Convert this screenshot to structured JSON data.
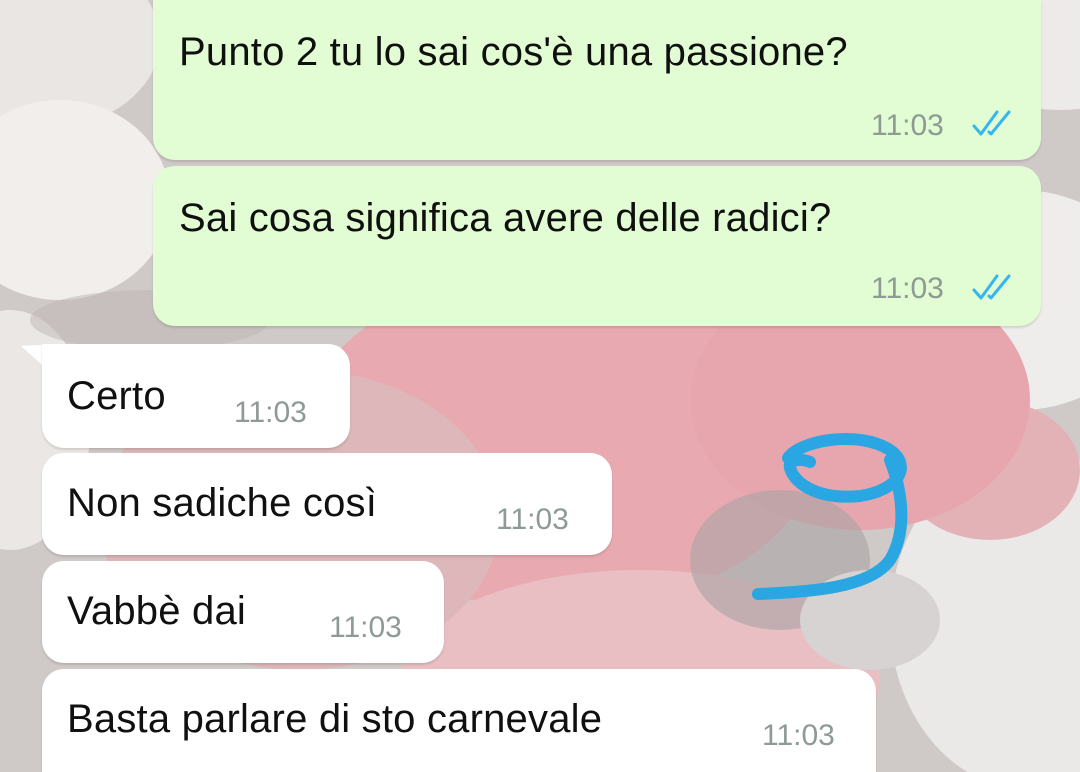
{
  "chat": {
    "messages": [
      {
        "direction": "outgoing",
        "text": "Punto 2 tu lo sai cos'è una passione?",
        "time": "11:03",
        "status_icon": "double-check-icon",
        "status_color": "#34b7f1"
      },
      {
        "direction": "outgoing",
        "text": "Sai cosa significa avere delle radici?",
        "time": "11:03",
        "status_icon": "double-check-icon",
        "status_color": "#34b7f1"
      },
      {
        "direction": "incoming",
        "text": "Certo",
        "time": "11:03"
      },
      {
        "direction": "incoming",
        "text": "Non sadiche così",
        "time": "11:03"
      },
      {
        "direction": "incoming",
        "text": "Vabbè dai",
        "time": "11:03"
      },
      {
        "direction": "incoming",
        "text": "Basta parlare di sto carnevale",
        "time": "11:03"
      }
    ]
  },
  "colors": {
    "outgoing_bubble": "#e2fdd3",
    "incoming_bubble": "#ffffff",
    "read_ticks": "#34b7f1",
    "doodle": "#2aa6e2"
  },
  "doodle": {
    "shape": "hand-drawn-9"
  }
}
